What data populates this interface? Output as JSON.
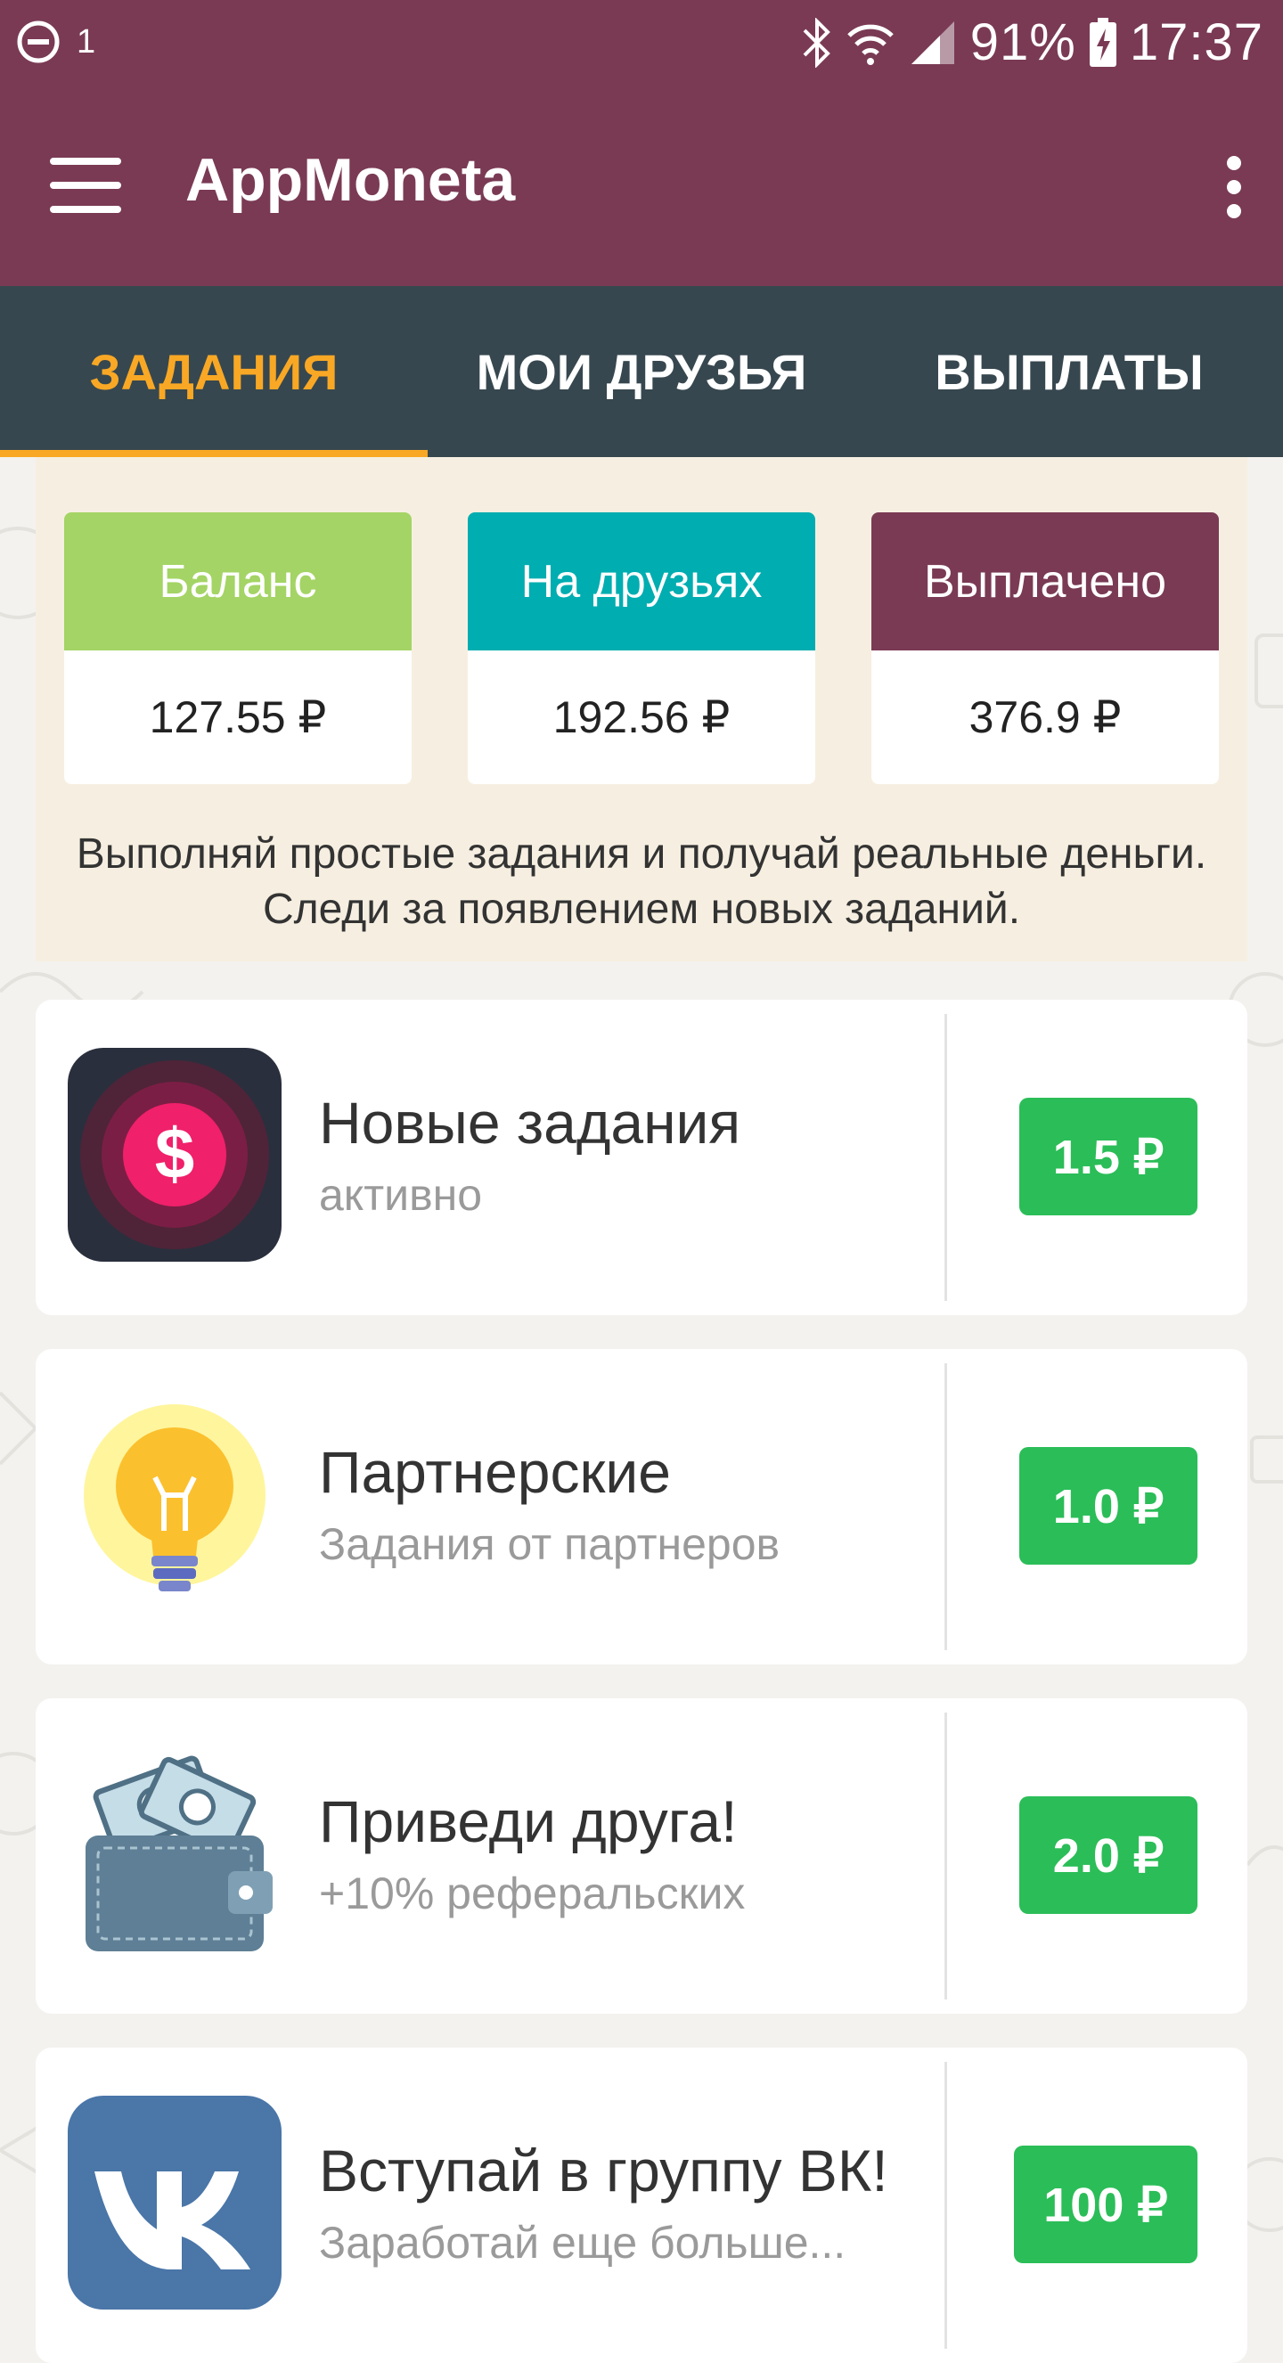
{
  "status_bar": {
    "notification_count": "1",
    "battery": "91%",
    "time": "17:37",
    "icons": [
      "do-not-disturb-icon",
      "bluetooth-icon",
      "wifi-icon",
      "signal-icon",
      "battery-charging-icon"
    ]
  },
  "app_bar": {
    "title": "AppMoneta",
    "background_color": "#7a3a54"
  },
  "tabs": [
    {
      "label": "ЗАДАНИЯ",
      "active": true
    },
    {
      "label": "МОИ ДРУЗЬЯ",
      "active": false
    },
    {
      "label": "ВЫПЛАТЫ",
      "active": false
    }
  ],
  "colors": {
    "tab_bar": "#37474f",
    "active_tab": "#f9a825",
    "reward_green": "#2bbd58"
  },
  "stats": [
    {
      "label": "Баланс",
      "value": "127.55 ₽",
      "color": "#a4d465"
    },
    {
      "label": "На друзьях",
      "value": "192.56 ₽",
      "color": "#00adb0"
    },
    {
      "label": "Выплачено",
      "value": "376.9 ₽",
      "color": "#7a3a54"
    }
  ],
  "stats_description": "Выполняй простые задания и получай реальные деньги. Следи за появлением новых заданий.",
  "tasks": [
    {
      "title": "Новые задания",
      "subtitle": "активно",
      "reward": "1.5 ₽",
      "icon": "dollar-coin-icon"
    },
    {
      "title": "Партнерские",
      "subtitle": "Задания от партнеров",
      "reward": "1.0 ₽",
      "icon": "lightbulb-icon"
    },
    {
      "title": "Приведи друга!",
      "subtitle": "+10% реферальских",
      "reward": "2.0 ₽",
      "icon": "wallet-icon"
    },
    {
      "title": "Вступай в группу ВК!",
      "subtitle": "Заработай еще больше...",
      "reward": "100 ₽",
      "icon": "vk-logo-icon"
    }
  ]
}
